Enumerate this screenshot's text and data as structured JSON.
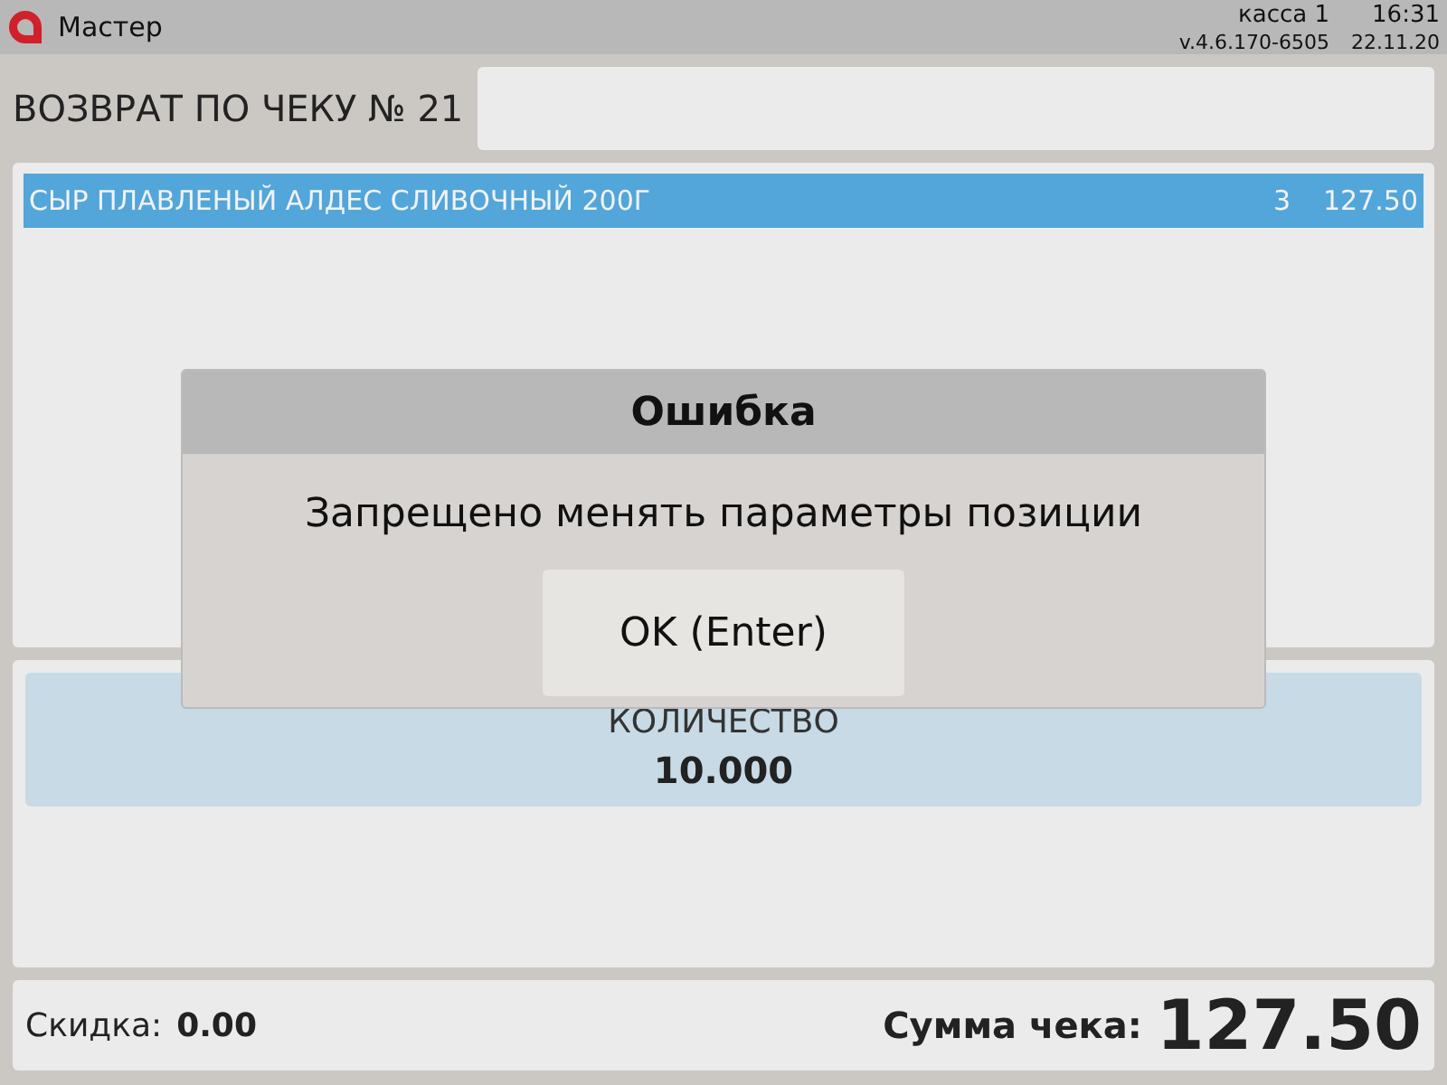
{
  "top_bar": {
    "title": "Мастер",
    "register": "касса 1",
    "time": "16:31",
    "version": "v.4.6.170-6505",
    "date": "22.11.20"
  },
  "header": {
    "title": "ВОЗВРАТ ПО ЧЕКУ № 21"
  },
  "items": [
    {
      "name": "СЫР ПЛАВЛЕНЫЙ АЛДЕС СЛИВОЧНЫЙ 200Г",
      "qty": "3",
      "sum": "127.50",
      "selected": true
    }
  ],
  "quantity": {
    "label": "КОЛИЧЕСТВО",
    "value": "10.000"
  },
  "footer": {
    "discount_label": "Скидка:",
    "discount": "0.00",
    "total_label": "Сумма чека:",
    "total": "127.50"
  },
  "dialog": {
    "title": "Ошибка",
    "message": "Запрещено менять параметры позиции",
    "button": "OK (Enter)"
  }
}
